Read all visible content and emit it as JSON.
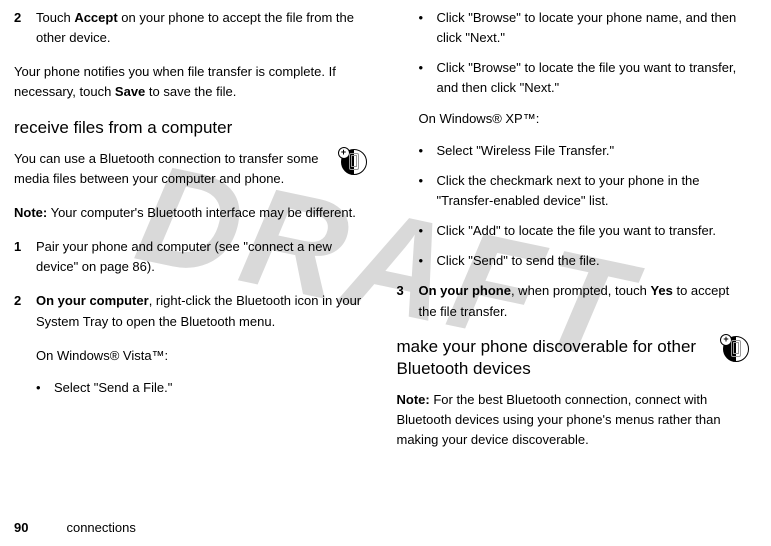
{
  "watermark": "DRAFT",
  "left": {
    "step2_num": "2",
    "step2_text_a": "Touch ",
    "step2_text_b": "Accept",
    "step2_text_c": " on your phone to accept the file from the other device.",
    "notify_a": "Your phone notifies you when file transfer is complete. If necessary, touch ",
    "notify_b": "Save",
    "notify_c": " to save the file.",
    "heading_receive": "receive files from a computer",
    "receive_intro": "You can use a Bluetooth connection to transfer some media files between your computer and phone.",
    "note_label": "Note:",
    "note_text": " Your computer's Bluetooth interface may be different.",
    "s1_num": "1",
    "s1_text": "Pair your phone and computer (see \"connect a new device\" on page 86).",
    "s2_num": "2",
    "s2_label": "On your computer",
    "s2_text": ", right-click the Bluetooth icon in your System Tray to open the Bluetooth menu.",
    "vista_line": "On Windows® Vista™:",
    "vista_b1": "Select \"Send a File.\""
  },
  "right": {
    "vista_b2": "Click \"Browse\" to locate your phone name, and then click \"Next.\"",
    "vista_b3": "Click \"Browse\" to locate the file you want to transfer, and then click \"Next.\"",
    "xp_line": "On Windows® XP™:",
    "xp_b1": "Select \"Wireless File Transfer.\"",
    "xp_b2": "Click the checkmark next to your phone in the \"Transfer-enabled device\" list.",
    "xp_b3": "Click \"Add\" to locate the file you want to transfer.",
    "xp_b4": "Click \"Send\" to send the file.",
    "s3_num": "3",
    "s3_label": "On your phone",
    "s3_text_a": ", when prompted, touch ",
    "s3_text_b": "Yes",
    "s3_text_c": " to accept the file transfer.",
    "heading_discover": "make your phone discoverable for other Bluetooth devices",
    "disc_note_label": "Note:",
    "disc_note_text": " For the best Bluetooth connection, connect with Bluetooth devices using your phone's menus rather than making your device discoverable."
  },
  "footer": {
    "page_num": "90",
    "section": "connections"
  },
  "bullet": "•"
}
